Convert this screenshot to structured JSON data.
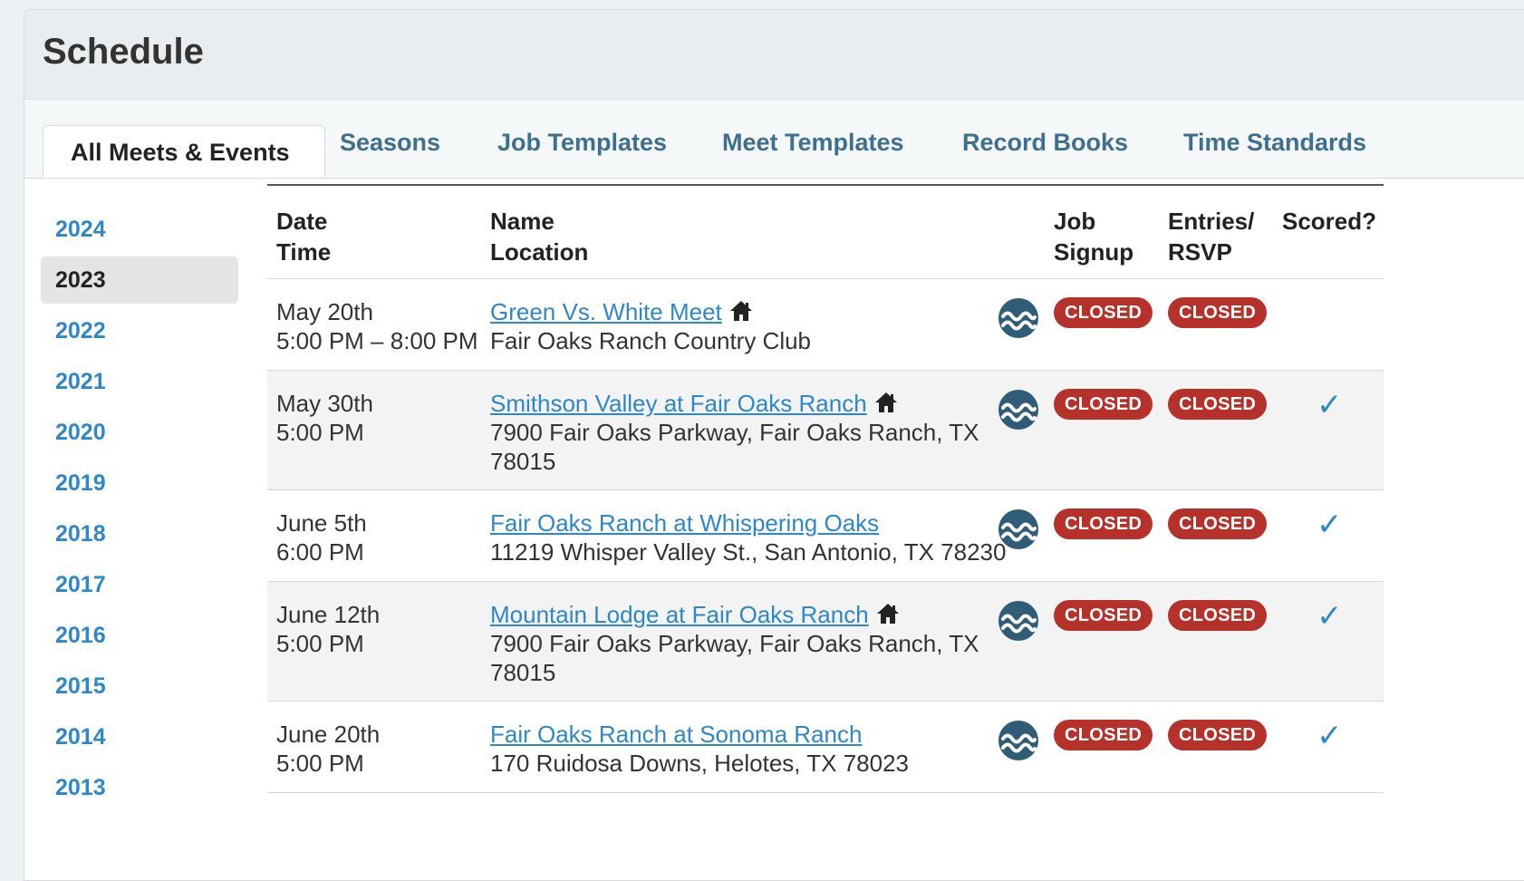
{
  "header": {
    "title": "Schedule"
  },
  "tabs": [
    {
      "label": "All Meets & Events",
      "active": true
    },
    {
      "label": "Seasons"
    },
    {
      "label": "Job Templates"
    },
    {
      "label": "Meet Templates"
    },
    {
      "label": "Record Books"
    },
    {
      "label": "Time Standards"
    }
  ],
  "years": {
    "items": [
      "2024",
      "2023",
      "2022",
      "2021",
      "2020",
      "2019",
      "2018",
      "2017",
      "2016",
      "2015",
      "2014",
      "2013"
    ],
    "active": "2023"
  },
  "table": {
    "headers": {
      "date": "Date",
      "time": "Time",
      "name": "Name",
      "location": "Location",
      "job1": "Job",
      "job2": "Signup",
      "entries1": "Entries/",
      "entries2": "RSVP",
      "scored": "Scored?"
    },
    "rows": [
      {
        "date": "May 20th",
        "time": "5:00 PM – 8:00 PM",
        "name": "Green Vs. White Meet",
        "home": true,
        "location": "Fair Oaks Ranch Country Club",
        "job": "CLOSED",
        "entries": "CLOSED",
        "scored": false
      },
      {
        "date": "May 30th",
        "time": "5:00 PM",
        "name": "Smithson Valley at Fair Oaks Ranch",
        "home": true,
        "location": "7900 Fair Oaks Parkway, Fair Oaks Ranch, TX 78015",
        "job": "CLOSED",
        "entries": "CLOSED",
        "scored": true
      },
      {
        "date": "June 5th",
        "time": "6:00 PM",
        "name": "Fair Oaks Ranch at Whispering Oaks",
        "home": false,
        "location": "11219 Whisper Valley St., San Antonio, TX 78230",
        "job": "CLOSED",
        "entries": "CLOSED",
        "scored": true
      },
      {
        "date": "June 12th",
        "time": "5:00 PM",
        "name": "Mountain Lodge at Fair Oaks Ranch",
        "home": true,
        "location": "7900 Fair Oaks Parkway, Fair Oaks Ranch, TX 78015",
        "job": "CLOSED",
        "entries": "CLOSED",
        "scored": true
      },
      {
        "date": "June 20th",
        "time": "5:00 PM",
        "name": "Fair Oaks Ranch at Sonoma Ranch",
        "home": false,
        "location": "170 Ruidosa Downs, Helotes, TX 78023",
        "job": "CLOSED",
        "entries": "CLOSED",
        "scored": true
      }
    ]
  },
  "icons": {
    "home": "home-icon",
    "wave": "wave-icon",
    "check": "check-icon"
  },
  "colors": {
    "link": "#2e87c7",
    "closed_badge": "#b5312a",
    "tab_text": "#3f6f8f"
  }
}
